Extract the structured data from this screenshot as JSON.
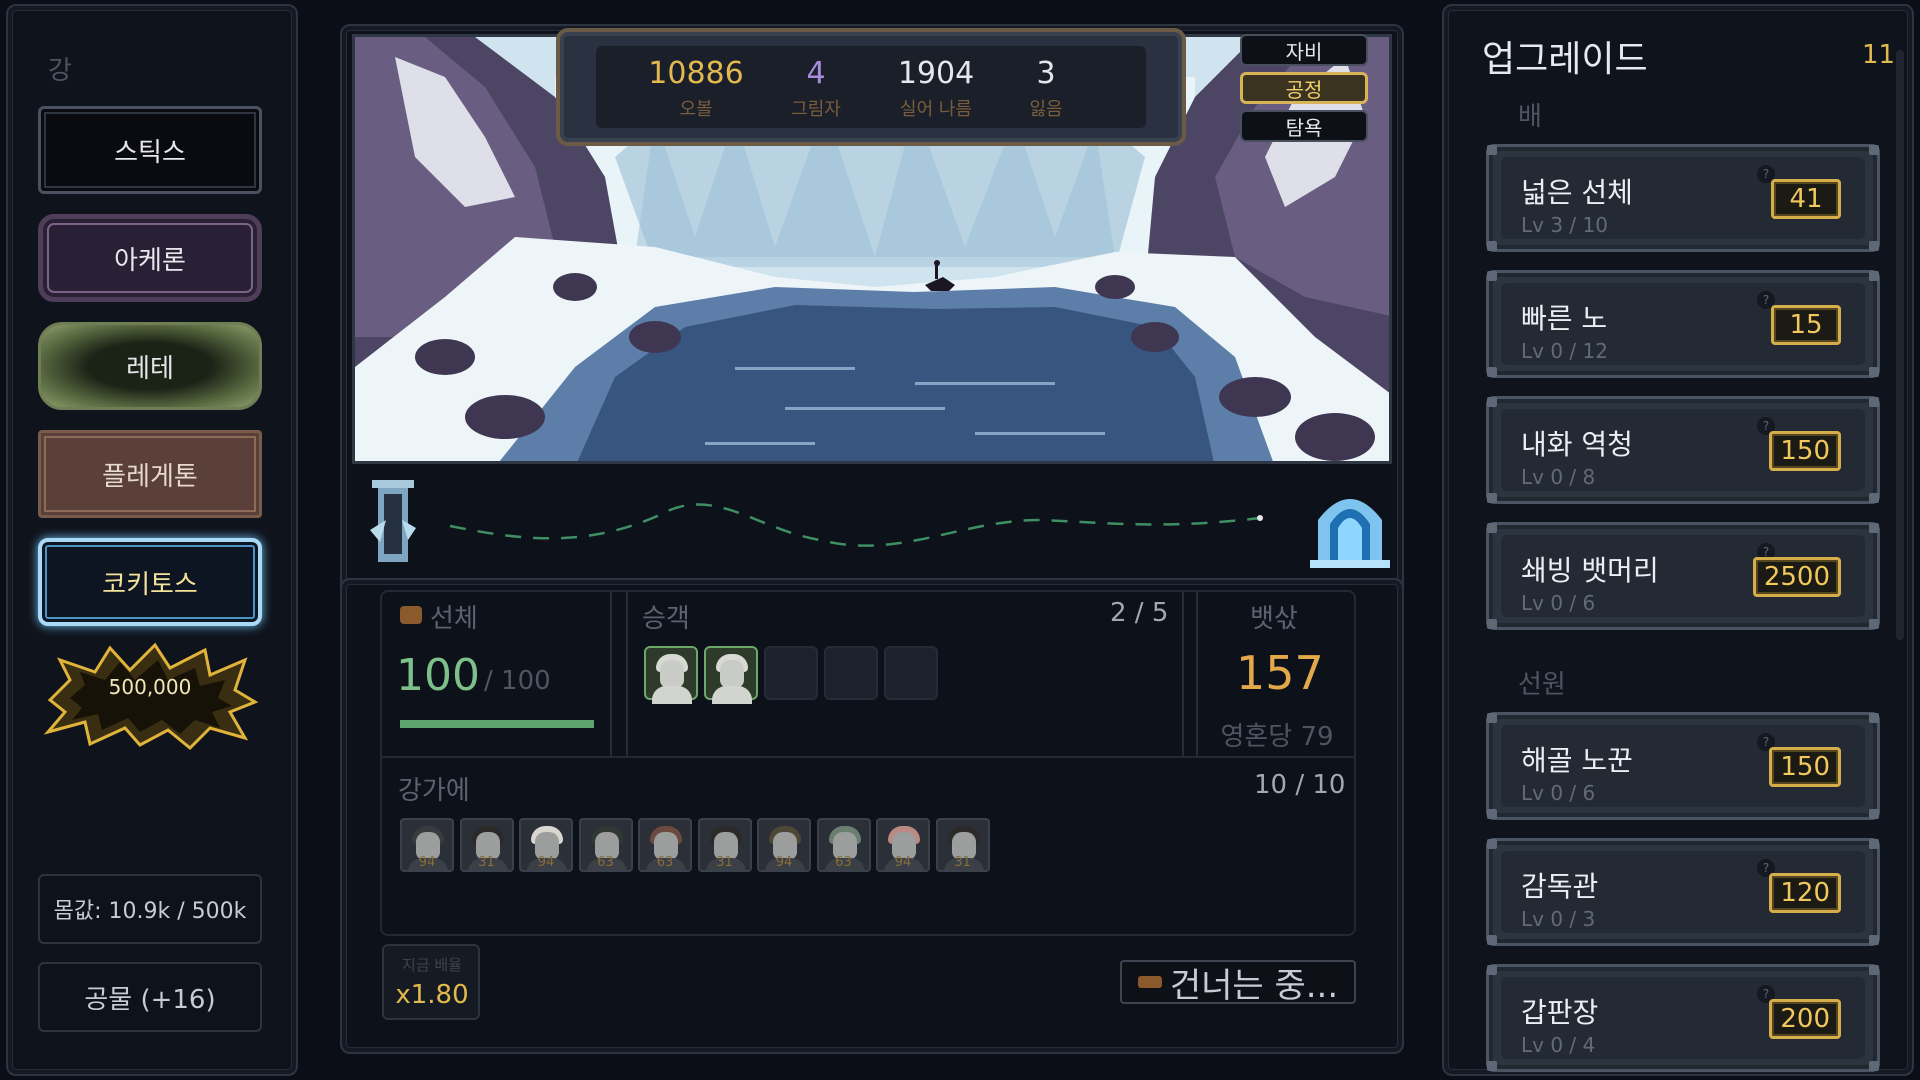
{
  "left": {
    "river_label": "강",
    "rivers": [
      "스틱스",
      "아케론",
      "레테",
      "플레게톤",
      "코키토스"
    ],
    "goal_amount": "500,000",
    "body_value": "몸값: 10.9k / 500k",
    "tribute": "공물 (+16)"
  },
  "stats": [
    {
      "value": "10886",
      "label": "오볼",
      "color": "#e2b94e"
    },
    {
      "value": "4",
      "label": "그림자",
      "color": "#a78bdc"
    },
    {
      "value": "1904",
      "label": "실어 나름",
      "color": "#e6e7ec"
    },
    {
      "value": "3",
      "label": "잃음",
      "color": "#e6e7ec"
    }
  ],
  "modes": {
    "greed": "자비",
    "fair": "공정",
    "avarice": "탐욕"
  },
  "hull": {
    "title": "선체",
    "value": "100",
    "max": "/ 100",
    "fraction": 1.0
  },
  "passengers": {
    "title": "승객",
    "count": "2 / 5",
    "filled": 2,
    "slots": 5
  },
  "fare": {
    "title": "뱃삯",
    "value": "157",
    "per_soul": "영혼당 79"
  },
  "waiting": {
    "title": "강가에",
    "count": "10 / 10",
    "souls": [
      "94",
      "31",
      "94",
      "63",
      "63",
      "31",
      "94",
      "63",
      "94",
      "31"
    ]
  },
  "speed": {
    "label": "지금 배율",
    "value": "x1.80"
  },
  "crossing": "건너는 중...",
  "upgrades": {
    "title": "업그레이드",
    "count": "11",
    "boat_section": "배",
    "crew_section": "선원",
    "help": "?",
    "boat": [
      {
        "name": "넓은 선체",
        "level": "Lv 3 / 10",
        "price": "41"
      },
      {
        "name": "빠른 노",
        "level": "Lv 0 / 12",
        "price": "15"
      },
      {
        "name": "내화 역청",
        "level": "Lv 0 / 8",
        "price": "150"
      },
      {
        "name": "쇄빙 뱃머리",
        "level": "Lv 0 / 6",
        "price": "2500"
      }
    ],
    "crew": [
      {
        "name": "해골 노꾼",
        "level": "Lv 0 / 6",
        "price": "150"
      },
      {
        "name": "감독관",
        "level": "Lv 0 / 3",
        "price": "120"
      },
      {
        "name": "갑판장",
        "level": "Lv 0 / 4",
        "price": "200"
      }
    ]
  }
}
